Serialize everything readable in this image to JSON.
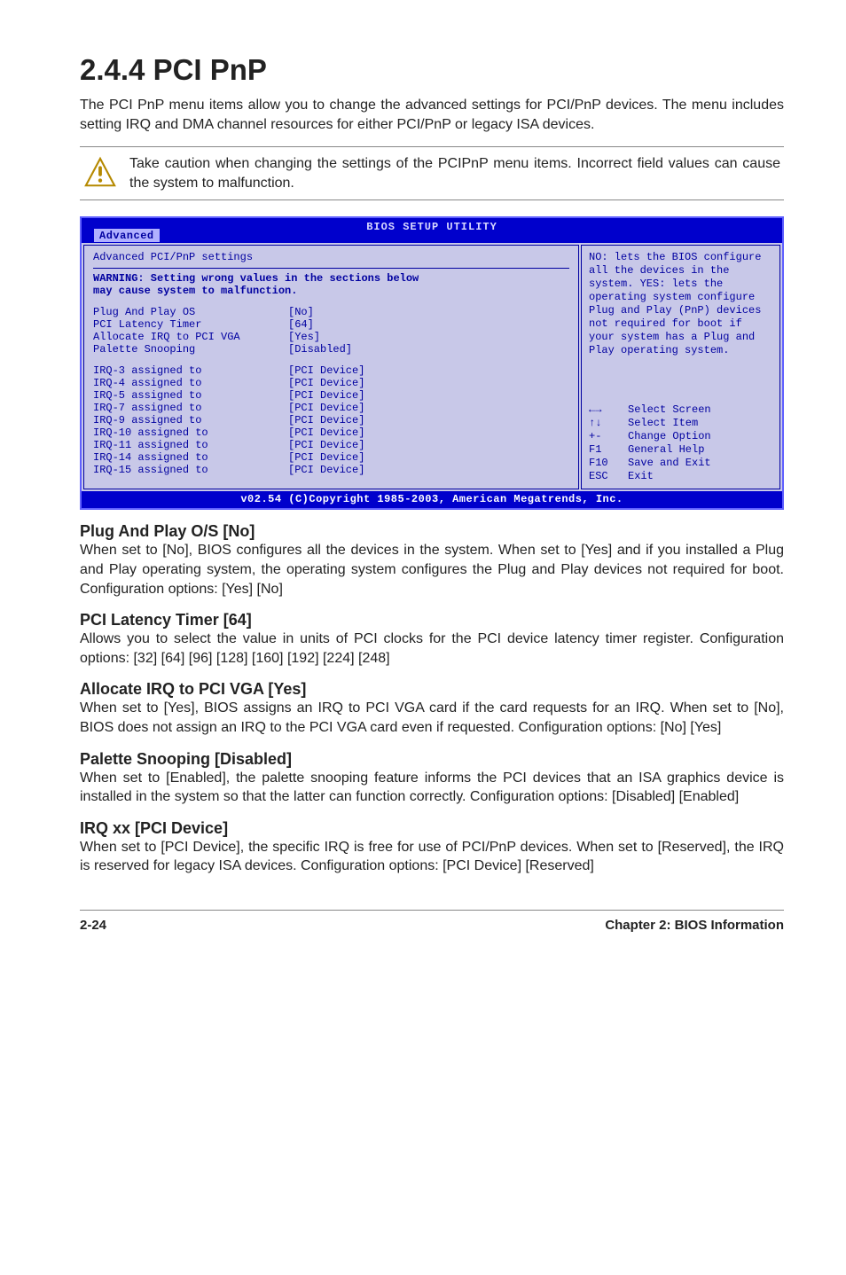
{
  "heading": "2.4.4   PCI PnP",
  "intro": "The PCI PnP menu items allow you to change the advanced settings for PCI/PnP devices. The menu includes setting IRQ and DMA channel resources for either PCI/PnP or legacy ISA devices.",
  "note": "Take caution when changing the settings of the PCIPnP menu items. Incorrect field values can cause the system to malfunction.",
  "bios": {
    "header_title": "BIOS SETUP UTILITY",
    "tab": "Advanced",
    "subtitle": "Advanced PCI/PnP settings",
    "warning_line1": "WARNING: Setting wrong values in the sections below",
    "warning_line2": "         may cause system to malfunction.",
    "settings1": [
      {
        "label": "Plug And Play OS",
        "value": "[No]"
      },
      {
        "label": "PCI Latency Timer",
        "value": "[64]"
      },
      {
        "label": "Allocate IRQ to PCI VGA",
        "value": "[Yes]"
      },
      {
        "label": "Palette Snooping",
        "value": "[Disabled]"
      }
    ],
    "settings2": [
      {
        "label": "IRQ-3 assigned to",
        "value": "[PCI Device]"
      },
      {
        "label": "IRQ-4 assigned to",
        "value": "[PCI Device]"
      },
      {
        "label": "IRQ-5 assigned to",
        "value": "[PCI Device]"
      },
      {
        "label": "IRQ-7 assigned to",
        "value": "[PCI Device]"
      },
      {
        "label": "IRQ-9 assigned to",
        "value": "[PCI Device]"
      },
      {
        "label": "IRQ-10 assigned to",
        "value": "[PCI Device]"
      },
      {
        "label": "IRQ-11 assigned to",
        "value": "[PCI Device]"
      },
      {
        "label": "IRQ-14 assigned to",
        "value": "[PCI Device]"
      },
      {
        "label": "IRQ-15 assigned to",
        "value": "[PCI Device]"
      }
    ],
    "help": "NO: lets the BIOS configure all the devices in the system. YES: lets the operating system configure Plug and Play (PnP) devices not required for boot if your system has a Plug and Play operating system.",
    "nav": [
      {
        "key": "←→",
        "action": "Select Screen"
      },
      {
        "key": "↑↓",
        "action": "Select Item"
      },
      {
        "key": "+-",
        "action": "Change Option"
      },
      {
        "key": "F1",
        "action": "General Help"
      },
      {
        "key": "F10",
        "action": "Save and Exit"
      },
      {
        "key": "ESC",
        "action": "Exit"
      }
    ],
    "footer": "v02.54 (C)Copyright 1985-2003, American Megatrends, Inc."
  },
  "subsections": [
    {
      "title": "Plug And Play O/S [No]",
      "body": "When set to [No], BIOS configures all the devices in the system. When set to [Yes] and if you installed a Plug and Play operating system, the operating system configures the Plug and Play devices not required for boot. Configuration options: [Yes] [No]"
    },
    {
      "title": "PCI Latency Timer [64]",
      "body": "Allows you to select the value in units of PCI clocks for the PCI device latency timer register. Configuration options: [32] [64] [96] [128] [160] [192] [224] [248]"
    },
    {
      "title": "Allocate IRQ to PCI VGA [Yes]",
      "body": "When set to [Yes], BIOS assigns an IRQ to PCI VGA card if the card requests for an IRQ. When set to [No], BIOS does not assign an IRQ to the PCI VGA card even if requested. Configuration options: [No] [Yes]"
    },
    {
      "title": "Palette Snooping [Disabled]",
      "body": "When set to [Enabled], the palette snooping feature informs the PCI devices that an ISA graphics device is installed in the system so that the latter can function correctly. Configuration options: [Disabled] [Enabled]"
    },
    {
      "title": "IRQ xx [PCI Device]",
      "body": "When set to [PCI Device], the specific IRQ is free for use of PCI/PnP devices. When set to [Reserved], the IRQ is reserved for legacy ISA devices. Configuration options: [PCI Device] [Reserved]"
    }
  ],
  "page_footer": {
    "left": "2-24",
    "right": "Chapter 2: BIOS Information"
  }
}
